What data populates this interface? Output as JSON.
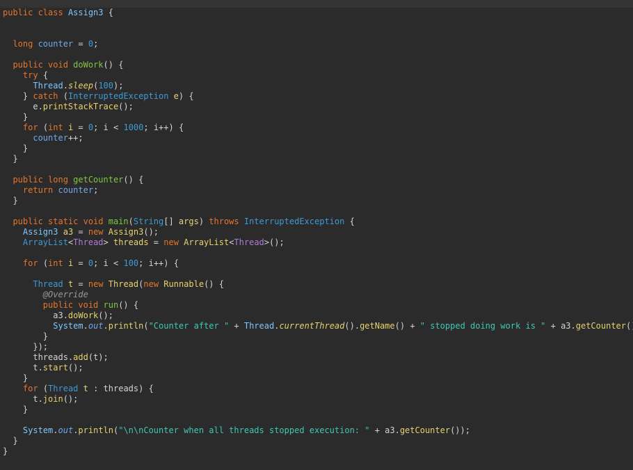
{
  "editor": {
    "lines": [
      [
        [
          "kw",
          "public "
        ],
        [
          "kw",
          "class "
        ],
        [
          "cls",
          "Assign3"
        ],
        [
          "txt",
          " {"
        ]
      ],
      [],
      [],
      [
        [
          "txt",
          "  "
        ],
        [
          "kw",
          "long "
        ],
        [
          "fld",
          "counter"
        ],
        [
          "txt",
          " = "
        ],
        [
          "num",
          "0"
        ],
        [
          "txt",
          ";"
        ]
      ],
      [],
      [
        [
          "txt",
          "  "
        ],
        [
          "kw",
          "public "
        ],
        [
          "kw",
          "void "
        ],
        [
          "mth",
          "doWork"
        ],
        [
          "txt",
          "() {"
        ]
      ],
      [
        [
          "txt",
          "    "
        ],
        [
          "kw",
          "try"
        ],
        [
          "txt",
          " {"
        ]
      ],
      [
        [
          "txt",
          "      "
        ],
        [
          "cls",
          "Thread"
        ],
        [
          "txt",
          "."
        ],
        [
          "itl mth2",
          "sleep"
        ],
        [
          "txt",
          "("
        ],
        [
          "num",
          "100"
        ],
        [
          "txt",
          ");"
        ]
      ],
      [
        [
          "txt",
          "    } "
        ],
        [
          "kw",
          "catch"
        ],
        [
          "txt",
          " ("
        ],
        [
          "typ",
          "InterruptedException"
        ],
        [
          "txt",
          " "
        ],
        [
          "var",
          "e"
        ],
        [
          "txt",
          ") {"
        ]
      ],
      [
        [
          "txt",
          "      e."
        ],
        [
          "mth2",
          "printStackTrace"
        ],
        [
          "txt",
          "();"
        ]
      ],
      [
        [
          "txt",
          "    }"
        ]
      ],
      [
        [
          "txt",
          "    "
        ],
        [
          "kw",
          "for"
        ],
        [
          "txt",
          " ("
        ],
        [
          "kw",
          "int "
        ],
        [
          "var",
          "i"
        ],
        [
          "txt",
          " = "
        ],
        [
          "num",
          "0"
        ],
        [
          "txt",
          "; i < "
        ],
        [
          "num",
          "1000"
        ],
        [
          "txt",
          "; i++) {"
        ]
      ],
      [
        [
          "txt",
          "      "
        ],
        [
          "fld",
          "counter"
        ],
        [
          "txt",
          "++;"
        ]
      ],
      [
        [
          "txt",
          "    }"
        ]
      ],
      [
        [
          "txt",
          "  }"
        ]
      ],
      [],
      [
        [
          "txt",
          "  "
        ],
        [
          "kw",
          "public "
        ],
        [
          "kw",
          "long "
        ],
        [
          "mth",
          "getCounter"
        ],
        [
          "txt",
          "() {"
        ]
      ],
      [
        [
          "txt",
          "    "
        ],
        [
          "kw",
          "return "
        ],
        [
          "fld",
          "counter"
        ],
        [
          "txt",
          ";"
        ]
      ],
      [
        [
          "txt",
          "  }"
        ]
      ],
      [],
      [
        [
          "txt",
          "  "
        ],
        [
          "kw",
          "public "
        ],
        [
          "kw",
          "static "
        ],
        [
          "kw",
          "void "
        ],
        [
          "mth",
          "main"
        ],
        [
          "txt",
          "("
        ],
        [
          "typ",
          "String"
        ],
        [
          "txt",
          "[] "
        ],
        [
          "var",
          "args"
        ],
        [
          "txt",
          ") "
        ],
        [
          "kw",
          "throws "
        ],
        [
          "typ",
          "InterruptedException"
        ],
        [
          "txt",
          " {"
        ]
      ],
      [
        [
          "txt",
          "    "
        ],
        [
          "cls",
          "Assign3"
        ],
        [
          "txt",
          " "
        ],
        [
          "var",
          "a3"
        ],
        [
          "txt",
          " = "
        ],
        [
          "kw",
          "new "
        ],
        [
          "mth2",
          "Assign3"
        ],
        [
          "txt",
          "();"
        ]
      ],
      [
        [
          "txt",
          "    "
        ],
        [
          "typ",
          "ArrayList"
        ],
        [
          "txt",
          "<"
        ],
        [
          "gen",
          "Thread"
        ],
        [
          "txt",
          "> "
        ],
        [
          "var",
          "threads"
        ],
        [
          "txt",
          " = "
        ],
        [
          "kw",
          "new "
        ],
        [
          "mth2",
          "ArrayList"
        ],
        [
          "txt",
          "<"
        ],
        [
          "gen",
          "Thread"
        ],
        [
          "txt",
          ">();"
        ]
      ],
      [],
      [
        [
          "txt",
          "    "
        ],
        [
          "kw",
          "for"
        ],
        [
          "txt",
          " ("
        ],
        [
          "kw",
          "int "
        ],
        [
          "var",
          "i"
        ],
        [
          "txt",
          " = "
        ],
        [
          "num",
          "0"
        ],
        [
          "txt",
          "; i < "
        ],
        [
          "num",
          "100"
        ],
        [
          "txt",
          "; i++) {"
        ]
      ],
      [],
      [
        [
          "txt",
          "      "
        ],
        [
          "typ",
          "Thread"
        ],
        [
          "txt",
          " "
        ],
        [
          "var",
          "t"
        ],
        [
          "txt",
          " = "
        ],
        [
          "kw",
          "new "
        ],
        [
          "mth2",
          "Thread"
        ],
        [
          "txt",
          "("
        ],
        [
          "kw",
          "new "
        ],
        [
          "mth2",
          "Runnable"
        ],
        [
          "txt",
          "() {"
        ]
      ],
      [
        [
          "txt",
          "        "
        ],
        [
          "ann",
          "@Override"
        ]
      ],
      [
        [
          "txt",
          "        "
        ],
        [
          "kw",
          "public "
        ],
        [
          "kw",
          "void "
        ],
        [
          "mth",
          "run"
        ],
        [
          "txt",
          "() {"
        ]
      ],
      [
        [
          "txt",
          "          a3."
        ],
        [
          "mth2",
          "doWork"
        ],
        [
          "txt",
          "();"
        ]
      ],
      [
        [
          "txt",
          "          "
        ],
        [
          "cls",
          "System"
        ],
        [
          "txt",
          "."
        ],
        [
          "itl fld",
          "out"
        ],
        [
          "txt",
          "."
        ],
        [
          "mth2",
          "println"
        ],
        [
          "txt",
          "("
        ],
        [
          "str",
          "\"Counter after \""
        ],
        [
          "txt",
          " + "
        ],
        [
          "cls",
          "Thread"
        ],
        [
          "txt",
          "."
        ],
        [
          "itl mth2",
          "currentThread"
        ],
        [
          "txt",
          "()."
        ],
        [
          "mth2",
          "getName"
        ],
        [
          "txt",
          "() + "
        ],
        [
          "str",
          "\" stopped doing work is \""
        ],
        [
          "txt",
          " + a3."
        ],
        [
          "mth2",
          "getCounter"
        ],
        [
          "txt",
          "());"
        ]
      ],
      [
        [
          "txt",
          "        }"
        ]
      ],
      [
        [
          "txt",
          "      });"
        ]
      ],
      [
        [
          "txt",
          "      threads."
        ],
        [
          "mth2",
          "add"
        ],
        [
          "txt",
          "(t);"
        ]
      ],
      [
        [
          "txt",
          "      t."
        ],
        [
          "mth2",
          "start"
        ],
        [
          "txt",
          "();"
        ]
      ],
      [
        [
          "txt",
          "    }"
        ]
      ],
      [
        [
          "txt",
          "    "
        ],
        [
          "kw",
          "for"
        ],
        [
          "txt",
          " ("
        ],
        [
          "typ",
          "Thread"
        ],
        [
          "txt",
          " "
        ],
        [
          "var",
          "t"
        ],
        [
          "txt",
          " : threads) {"
        ]
      ],
      [
        [
          "txt",
          "      t."
        ],
        [
          "mth2",
          "join"
        ],
        [
          "txt",
          "();"
        ]
      ],
      [
        [
          "txt",
          "    }"
        ]
      ],
      [],
      [
        [
          "txt",
          "    "
        ],
        [
          "cls",
          "System"
        ],
        [
          "txt",
          "."
        ],
        [
          "itl fld",
          "out"
        ],
        [
          "txt",
          "."
        ],
        [
          "mth2",
          "println"
        ],
        [
          "txt",
          "("
        ],
        [
          "str",
          "\"\\n\\nCounter when all threads stopped execution: \""
        ],
        [
          "txt",
          " + a3."
        ],
        [
          "mth2",
          "getCounter"
        ],
        [
          "txt",
          "());"
        ]
      ],
      [
        [
          "txt",
          "  }"
        ]
      ],
      [
        [
          "txt",
          "}"
        ]
      ]
    ],
    "colors": {
      "background": "#2b2b2b",
      "keyword": "#e6752c",
      "type": "#3e9ad6",
      "method": "#7fc742",
      "string": "#3fc8b5",
      "generic": "#b07cd9"
    }
  }
}
